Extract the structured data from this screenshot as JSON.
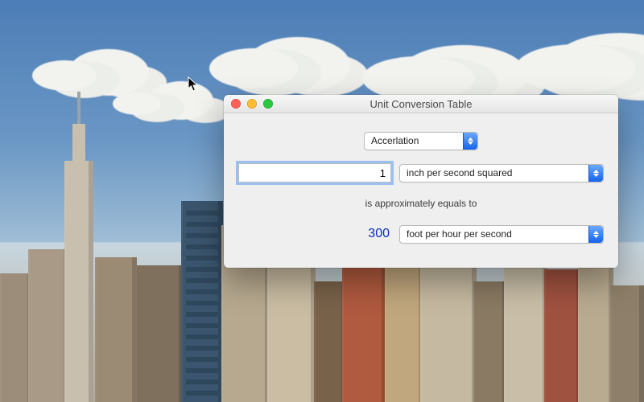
{
  "window": {
    "title": "Unit Conversion Table",
    "category": "Accerlation",
    "input": {
      "value": "1",
      "unit": "inch per second squared"
    },
    "approx_label": "is approximately equals to",
    "output": {
      "value": "300",
      "unit": "foot per hour per second"
    }
  }
}
